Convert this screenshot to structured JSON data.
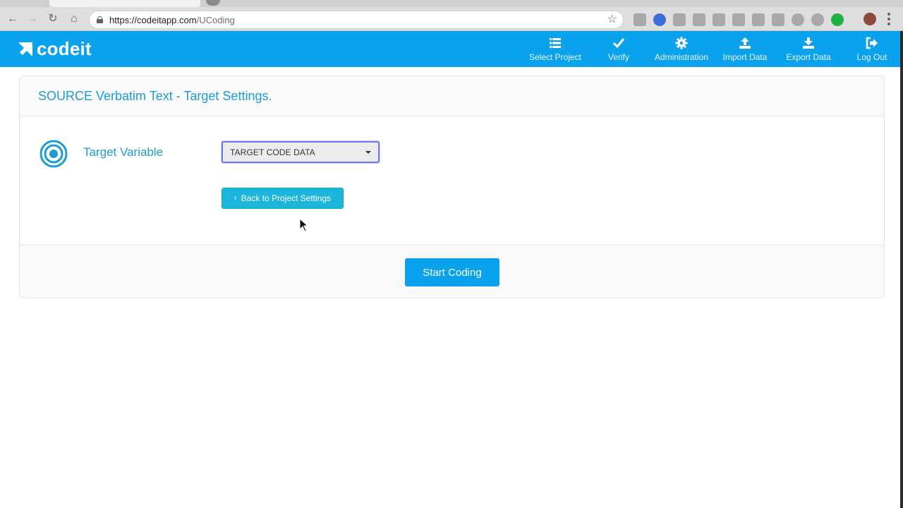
{
  "browser": {
    "url_domain": "https://codeitapp.com",
    "url_path": "/UCoding"
  },
  "brand": {
    "name": "codeit",
    "accent": "#0aa2ec",
    "title_color": "#1d9bd6",
    "button_cyan": "#1cb6dc"
  },
  "nav": {
    "items": [
      {
        "label": "Select Project",
        "icon": "list-icon"
      },
      {
        "label": "Verify",
        "icon": "check-icon"
      },
      {
        "label": "Administration",
        "icon": "gear-icon"
      },
      {
        "label": "Import Data",
        "icon": "upload-icon"
      },
      {
        "label": "Export Data",
        "icon": "download-icon"
      },
      {
        "label": "Log Out",
        "icon": "sign-out-icon"
      }
    ]
  },
  "panel": {
    "title": "SOURCE Verbatim Text - Target Settings.",
    "target_label": "Target Variable",
    "target_select_value": "TARGET CODE DATA",
    "back_button_label": "Back to Project Settings",
    "start_button_label": "Start Coding"
  }
}
